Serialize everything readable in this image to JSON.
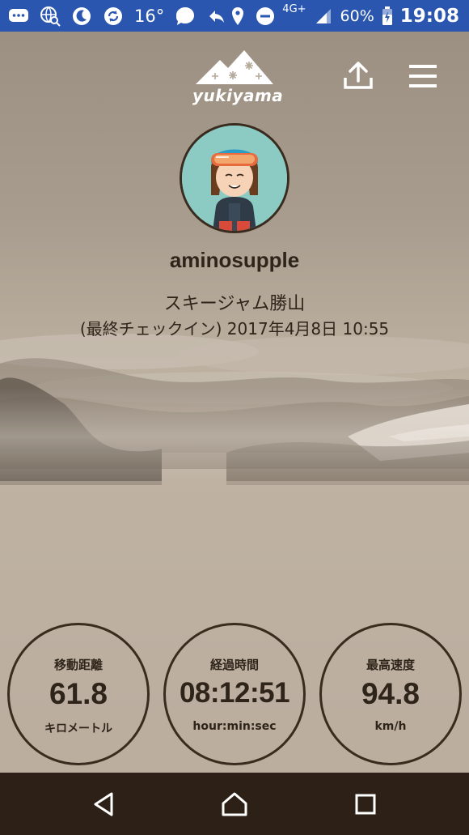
{
  "status_bar": {
    "temperature": "16°",
    "network": "4G+",
    "battery": "60%",
    "time": "19:08",
    "icons": [
      "message-icon",
      "globe-search-icon",
      "moon-icon",
      "sync-icon",
      "temperature-text",
      "chat-bubble-icon",
      "reply-icon",
      "location-pin-icon",
      "dnd-icon",
      "signal-icon",
      "battery-icon"
    ]
  },
  "header": {
    "logo_text": "yukiyama",
    "share_icon": "share-upload-icon",
    "menu_icon": "hamburger-menu-icon"
  },
  "profile": {
    "username": "aminosupple",
    "location": "スキージャム勝山",
    "checkin": "(最終チェックイン) 2017年4月8日 10:55"
  },
  "stats": [
    {
      "label": "移動距離",
      "value": "61.8",
      "unit": "キロメートル"
    },
    {
      "label": "経過時間",
      "value": "08:12:51",
      "unit": "hour:min:sec"
    },
    {
      "label": "最高速度",
      "value": "94.8",
      "unit": "km/h"
    }
  ],
  "nav": {
    "back_icon": "back-triangle-icon",
    "home_icon": "home-icon",
    "recents_icon": "recents-square-icon"
  },
  "colors": {
    "status_bar": "#2a56b0",
    "nav_bar": "#2d2016",
    "text": "#2e2419",
    "circle_border": "#3a2b1f"
  }
}
